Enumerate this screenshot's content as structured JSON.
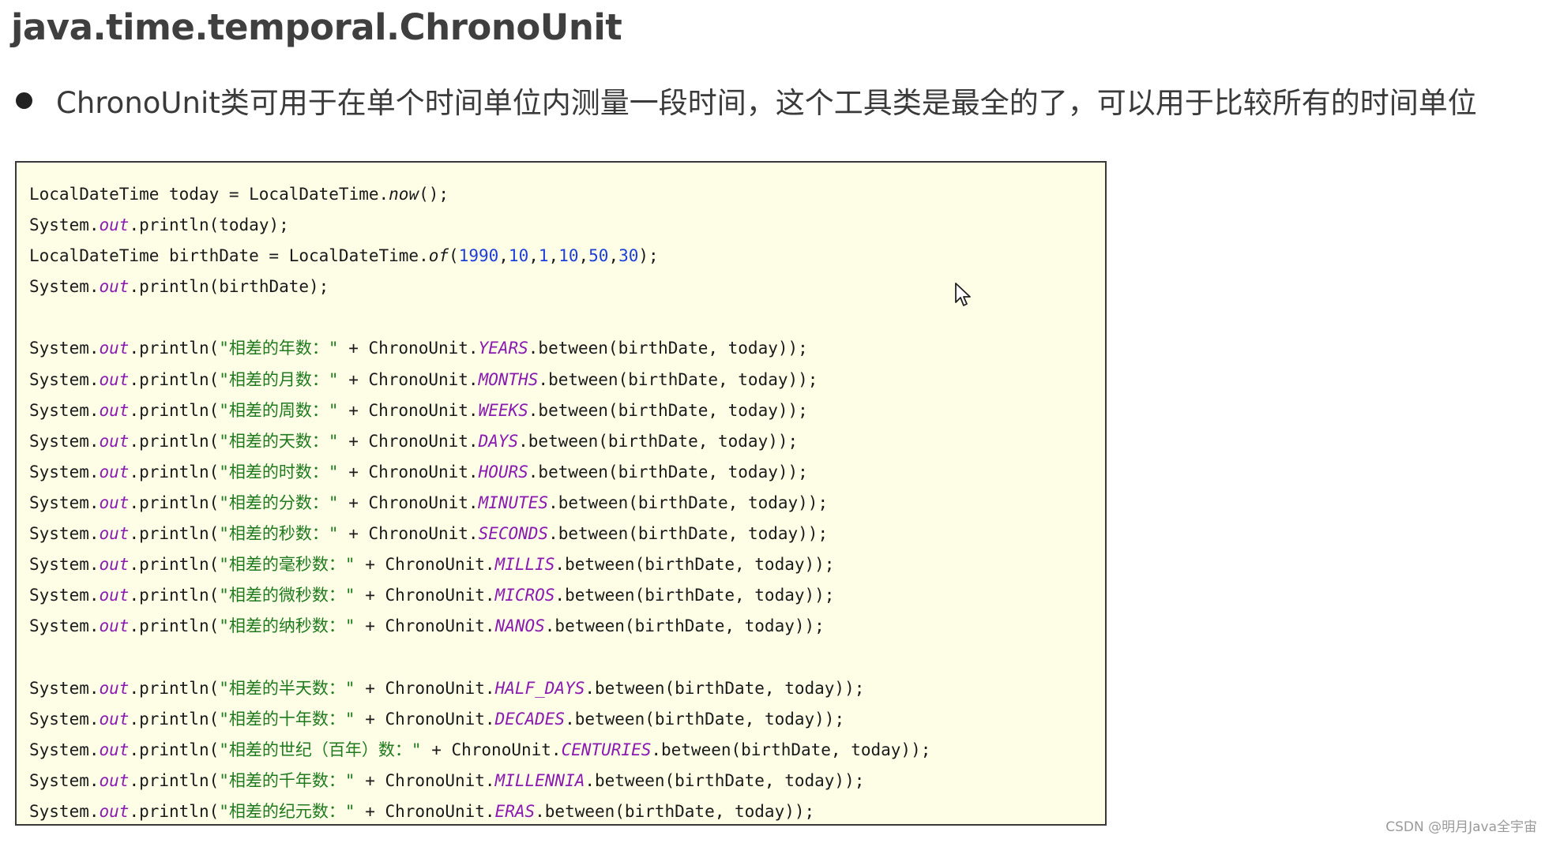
{
  "slide": {
    "title": "java.time.temporal.ChronoUnit",
    "bullet": "ChronoUnit类可用于在单个时间单位内测量一段时间，这个工具类是最全的了，可以用于比较所有的时间单位"
  },
  "code": {
    "lines": [
      "LocalDateTime today = LocalDateTime.now();",
      "System.out.println(today);",
      "LocalDateTime birthDate = LocalDateTime.of(1990,10,1,10,50,30);",
      "System.out.println(birthDate);",
      "",
      "System.out.println(\"相差的年数：\" + ChronoUnit.YEARS.between(birthDate, today));",
      "System.out.println(\"相差的月数：\" + ChronoUnit.MONTHS.between(birthDate, today));",
      "System.out.println(\"相差的周数：\" + ChronoUnit.WEEKS.between(birthDate, today));",
      "System.out.println(\"相差的天数：\" + ChronoUnit.DAYS.between(birthDate, today));",
      "System.out.println(\"相差的时数：\" + ChronoUnit.HOURS.between(birthDate, today));",
      "System.out.println(\"相差的分数：\" + ChronoUnit.MINUTES.between(birthDate, today));",
      "System.out.println(\"相差的秒数：\" + ChronoUnit.SECONDS.between(birthDate, today));",
      "System.out.println(\"相差的毫秒数：\" + ChronoUnit.MILLIS.between(birthDate, today));",
      "System.out.println(\"相差的微秒数：\" + ChronoUnit.MICROS.between(birthDate, today));",
      "System.out.println(\"相差的纳秒数：\" + ChronoUnit.NANOS.between(birthDate, today));",
      "",
      "System.out.println(\"相差的半天数：\" + ChronoUnit.HALF_DAYS.between(birthDate, today));",
      "System.out.println(\"相差的十年数：\" + ChronoUnit.DECADES.between(birthDate, today));",
      "System.out.println(\"相差的世纪（百年）数：\" + ChronoUnit.CENTURIES.between(birthDate, today));",
      "System.out.println(\"相差的千年数：\" + ChronoUnit.MILLENNIA.between(birthDate, today));",
      "System.out.println(\"相差的纪元数：\" + ChronoUnit.ERAS.between(birthDate, today));"
    ]
  },
  "watermark": "CSDN @明月Java全宇宙",
  "colors": {
    "code_background": "#fefde6",
    "static_field": "#8a1bb0",
    "string_literal": "#1f7a1f",
    "number_literal": "#1c3fd9",
    "text": "#1a1a1a"
  },
  "icons": {
    "cursor": "mouse-pointer-icon"
  }
}
